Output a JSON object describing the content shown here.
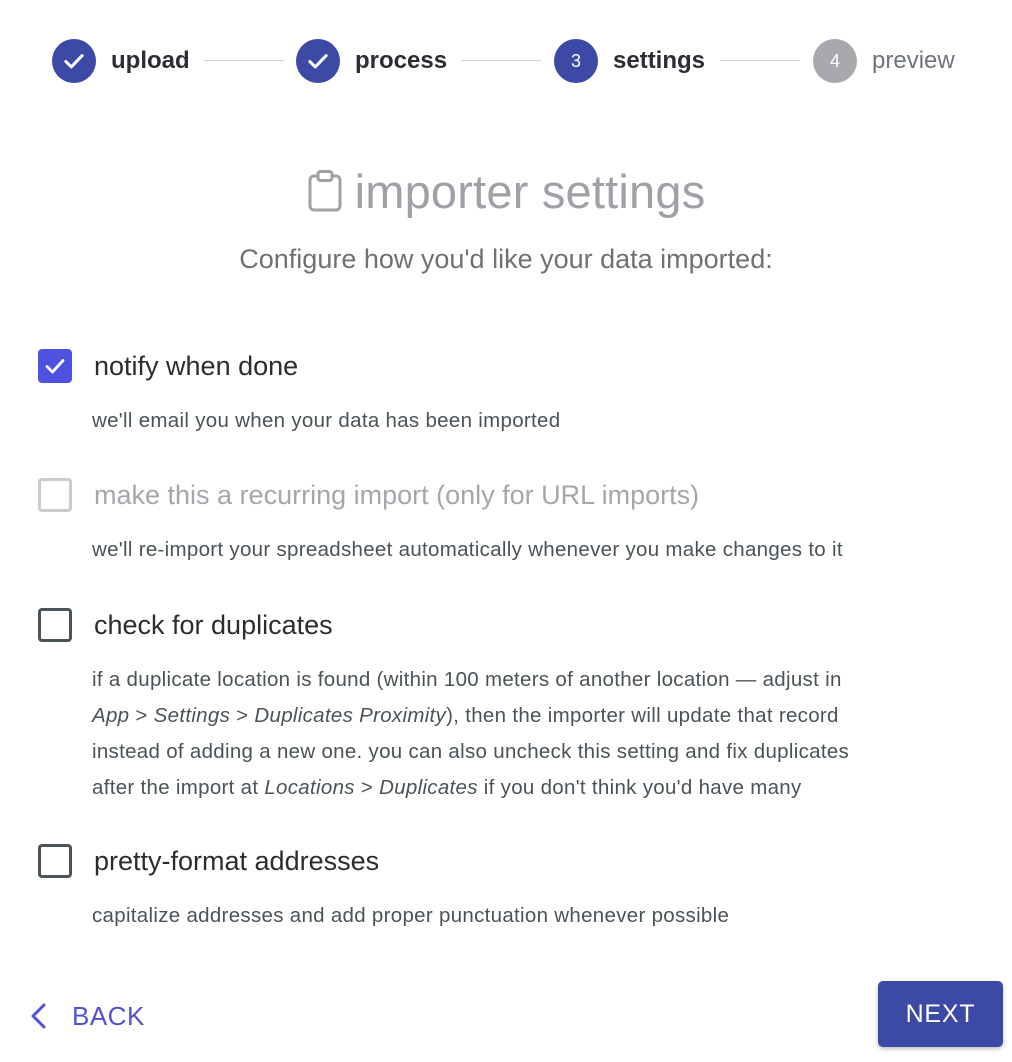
{
  "stepper": {
    "steps": [
      {
        "label": "upload",
        "state": "done",
        "icon": "check-icon"
      },
      {
        "label": "process",
        "state": "done",
        "icon": "check-icon"
      },
      {
        "label": "settings",
        "state": "active",
        "number": "3"
      },
      {
        "label": "preview",
        "state": "pending",
        "number": "4"
      }
    ]
  },
  "header": {
    "icon": "clipboard-icon",
    "title": "importer settings",
    "subtitle": "Configure how you'd like your data imported:"
  },
  "options": {
    "notify": {
      "label": "notify when done",
      "checked": true,
      "description": "we'll email you when your data has been imported"
    },
    "recurring": {
      "label": "make this a recurring import (only for URL imports)",
      "checked": false,
      "disabled": true,
      "description": "we'll re-import your spreadsheet automatically whenever you make changes to it"
    },
    "duplicates": {
      "label": "check for duplicates",
      "checked": false,
      "description": {
        "line1": "if a duplicate location is found (within 100 meters of another location — adjust in",
        "line2": {
          "app": "App",
          "sep1": " > ",
          "settings": "Settings",
          "sep2": " > ",
          "proximity": "Duplicates Proximity",
          "rest": "), then the importer will update that record"
        },
        "line3": "instead of adding a new one. you can also uncheck this setting and fix duplicates",
        "line4": {
          "pre": "after the import at ",
          "locations": "Locations",
          "sep": " > ",
          "duplicates": "Duplicates",
          "rest": " if you don't think you'd have many"
        }
      }
    },
    "pretty": {
      "label": "pretty-format addresses",
      "checked": false,
      "description": "capitalize addresses and add proper punctuation whenever possible"
    }
  },
  "footer": {
    "back_label": "BACK",
    "next_label": "NEXT"
  },
  "colors": {
    "primary": "#3c4aa6",
    "checkbox_checked": "#4f51e1",
    "link": "#5251d6",
    "pending": "#a9a9ad"
  }
}
